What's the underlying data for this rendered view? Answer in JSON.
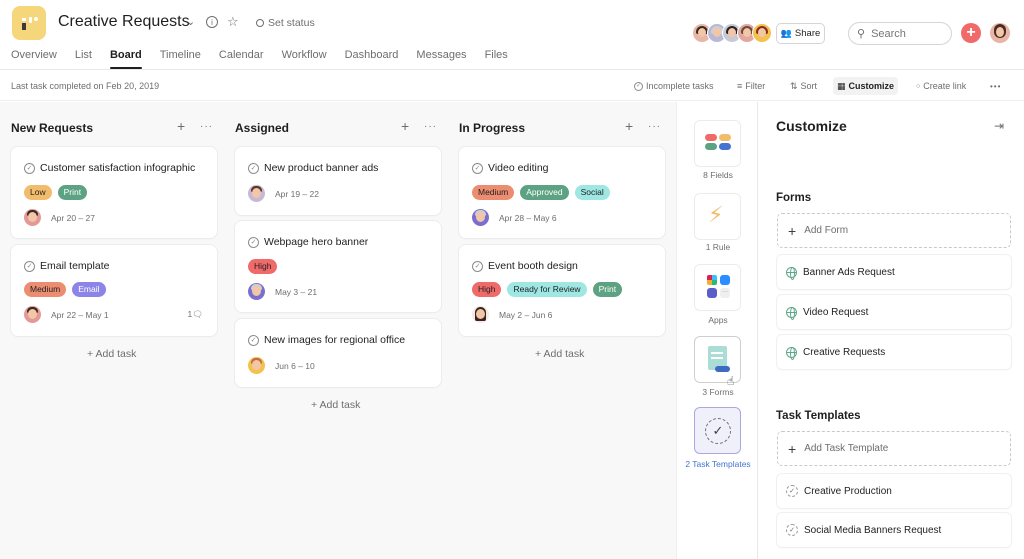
{
  "project": {
    "title": "Creative Requests",
    "set_status": "Set status",
    "logo_color": "#f6d67a"
  },
  "tabs": [
    {
      "label": "Overview"
    },
    {
      "label": "List"
    },
    {
      "label": "Board",
      "active": true
    },
    {
      "label": "Timeline"
    },
    {
      "label": "Calendar"
    },
    {
      "label": "Workflow"
    },
    {
      "label": "Dashboard"
    },
    {
      "label": "Messages"
    },
    {
      "label": "Files"
    }
  ],
  "header_right": {
    "share_label": "Share",
    "search_placeholder": "Search",
    "add_button": "+",
    "accent": "#f06a6a"
  },
  "subbar": {
    "last_task": "Last task completed on Feb 20, 2019",
    "incomplete": "Incomplete tasks",
    "filter": "Filter",
    "sort": "Sort",
    "customize": "Customize",
    "create_link": "Create link",
    "more": "•••"
  },
  "columns": [
    {
      "title": "New Requests",
      "add_task": "+ Add task",
      "cards": [
        {
          "title": "Customer satisfaction infographic",
          "tags": [
            {
              "label": "Low",
              "bg": "#f1bd6c",
              "fg": "#1e1f21"
            },
            {
              "label": "Print",
              "bg": "#5da283",
              "fg": "#ffffff"
            }
          ],
          "date": "Apr 20 – 27"
        },
        {
          "title": "Email template",
          "tags": [
            {
              "label": "Medium",
              "bg": "#ec8d71",
              "fg": "#1e1f21"
            },
            {
              "label": "Email",
              "bg": "#8d84e8",
              "fg": "#ffffff"
            }
          ],
          "date": "Apr 22 – May 1",
          "comments": "1"
        }
      ]
    },
    {
      "title": "Assigned",
      "add_task": "+ Add task",
      "cards": [
        {
          "title": "New product banner ads",
          "tags": [],
          "date": "Apr 19 – 22"
        },
        {
          "title": "Webpage hero banner",
          "tags": [
            {
              "label": "High",
              "bg": "#f06a6a",
              "fg": "#1e1f21"
            }
          ],
          "date": "May 3 – 21"
        },
        {
          "title": "New images for regional office",
          "tags": [],
          "date": "Jun 6 – 10"
        }
      ]
    },
    {
      "title": "In Progress",
      "add_task": "+ Add task",
      "cards": [
        {
          "title": "Video editing",
          "tags": [
            {
              "label": "Medium",
              "bg": "#ec8d71",
              "fg": "#1e1f21"
            },
            {
              "label": "Approved",
              "bg": "#5da283",
              "fg": "#ffffff"
            },
            {
              "label": "Social",
              "bg": "#9ee7e3",
              "fg": "#1e1f21"
            }
          ],
          "date": "Apr 28 – May 6"
        },
        {
          "title": "Event booth design",
          "tags": [
            {
              "label": "High",
              "bg": "#f06a6a",
              "fg": "#1e1f21"
            },
            {
              "label": "Ready for Review",
              "bg": "#9ee7e3",
              "fg": "#1e1f21"
            },
            {
              "label": "Print",
              "bg": "#5da283",
              "fg": "#ffffff"
            }
          ],
          "date": "May 2 – Jun 6"
        }
      ]
    }
  ],
  "rail": [
    {
      "label": "8 Fields"
    },
    {
      "label": "1 Rule"
    },
    {
      "label": "Apps"
    },
    {
      "label": "3 Forms"
    },
    {
      "label": "2 Task Templates",
      "active": true
    }
  ],
  "panel": {
    "title": "Customize",
    "forms_heading": "Forms",
    "add_form": "Add Form",
    "forms": [
      "Banner Ads Request",
      "Video Request",
      "Creative Requests"
    ],
    "templates_heading": "Task Templates",
    "add_template": "Add Task Template",
    "templates": [
      "Creative Production",
      "Social Media Banners Request"
    ]
  }
}
